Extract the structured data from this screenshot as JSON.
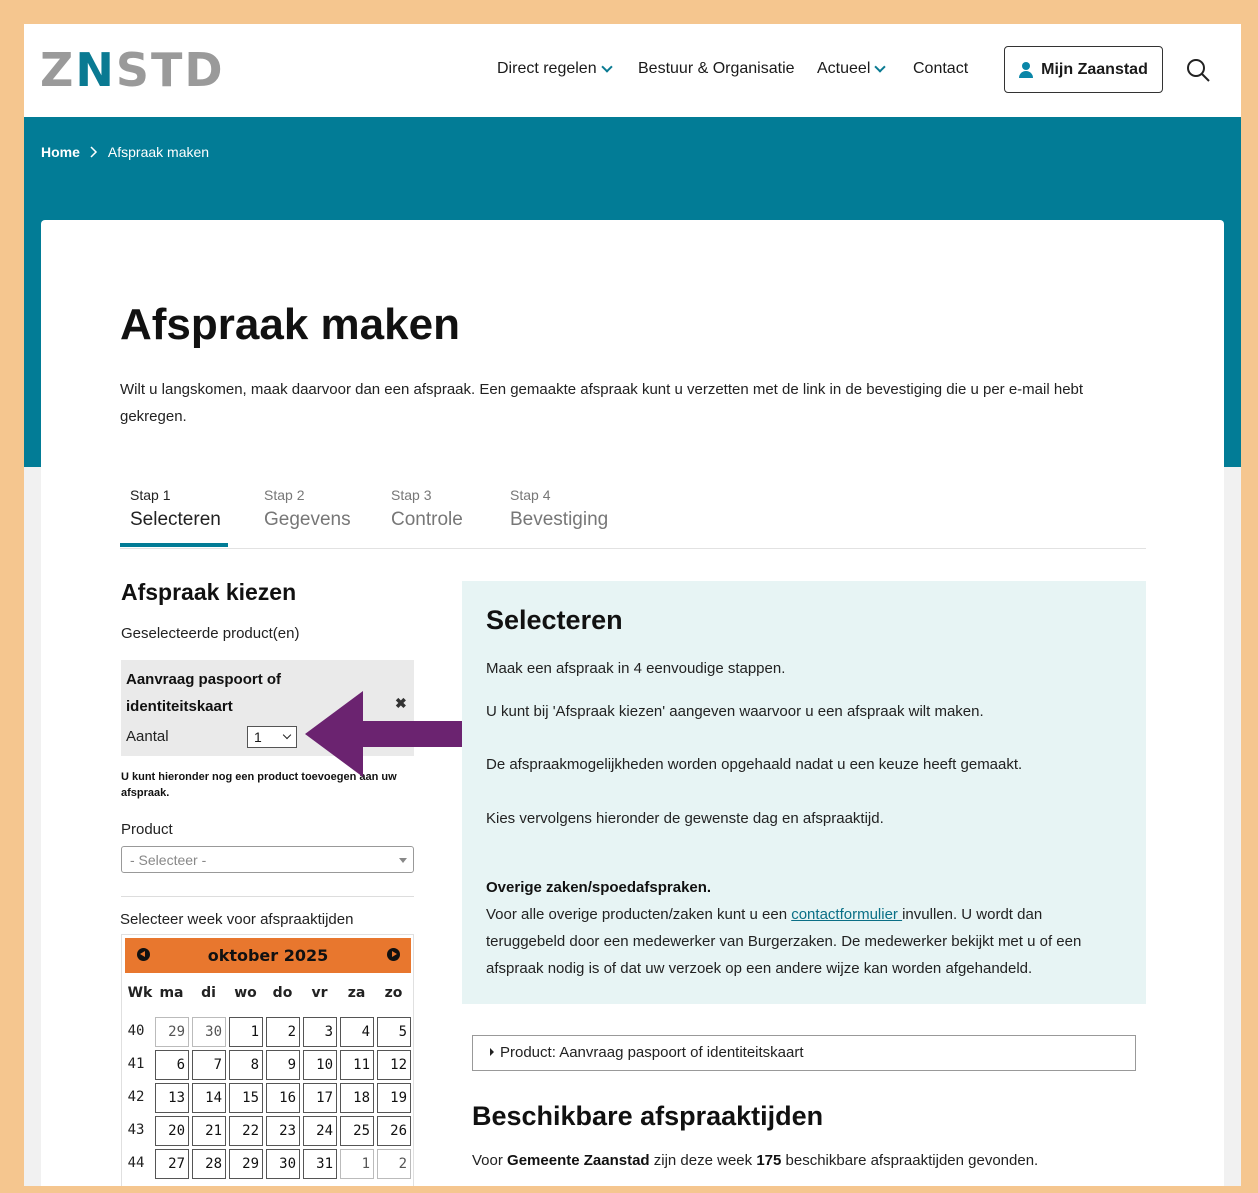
{
  "header": {
    "logo_prefix": "Z",
    "logo_n": "N",
    "logo_suffix": "STD",
    "nav": [
      {
        "label": "Direct regelen",
        "dropdown": true
      },
      {
        "label": "Bestuur & Organisatie",
        "dropdown": false
      },
      {
        "label": "Actueel",
        "dropdown": true
      },
      {
        "label": "Contact",
        "dropdown": false
      }
    ],
    "account_button": "Mijn Zaanstad",
    "search_icon": "search-icon"
  },
  "breadcrumb": {
    "home": "Home",
    "current": "Afspraak maken"
  },
  "page": {
    "title": "Afspraak maken",
    "intro": "Wilt u langskomen, maak daarvoor dan een afspraak. Een gemaakte afspraak kunt u verzetten met de link in de bevestiging die u per e-mail hebt gekregen."
  },
  "steps": [
    {
      "num": "Stap 1",
      "label": "Selecteren",
      "active": true
    },
    {
      "num": "Stap 2",
      "label": "Gegevens",
      "active": false
    },
    {
      "num": "Stap 3",
      "label": "Controle",
      "active": false
    },
    {
      "num": "Stap 4",
      "label": "Bevestiging",
      "active": false
    }
  ],
  "left": {
    "heading": "Afspraak kiezen",
    "selected_label": "Geselecteerde product(en)",
    "selected_product": "Aanvraag paspoort of identiteitskaart",
    "remove_icon": "close-icon",
    "aantal_label": "Aantal",
    "aantal_value": "1",
    "hint": "U kunt hieronder nog een product toevoegen aan uw afspraak.",
    "product_label": "Product",
    "product_placeholder": "- Selecteer -",
    "week_label": "Selecteer week voor afspraaktijden"
  },
  "calendar": {
    "month": "oktober 2025",
    "weekday_headers": [
      "Wk",
      "ma",
      "di",
      "wo",
      "do",
      "vr",
      "za",
      "zo"
    ],
    "rows": [
      {
        "week": "40",
        "days": [
          "29",
          "30",
          "1",
          "2",
          "3",
          "4",
          "5"
        ],
        "dim": [
          true,
          true,
          false,
          false,
          false,
          false,
          false
        ]
      },
      {
        "week": "41",
        "days": [
          "6",
          "7",
          "8",
          "9",
          "10",
          "11",
          "12"
        ],
        "dim": [
          false,
          false,
          false,
          false,
          false,
          false,
          false
        ]
      },
      {
        "week": "42",
        "days": [
          "13",
          "14",
          "15",
          "16",
          "17",
          "18",
          "19"
        ],
        "dim": [
          false,
          false,
          false,
          false,
          false,
          false,
          false
        ]
      },
      {
        "week": "43",
        "days": [
          "20",
          "21",
          "22",
          "23",
          "24",
          "25",
          "26"
        ],
        "dim": [
          false,
          false,
          false,
          false,
          false,
          false,
          false
        ]
      },
      {
        "week": "44",
        "days": [
          "27",
          "28",
          "29",
          "30",
          "31",
          "1",
          "2"
        ],
        "dim": [
          false,
          false,
          false,
          false,
          false,
          true,
          true
        ]
      }
    ],
    "colors": {
      "header": "#e8772e"
    }
  },
  "info": {
    "heading": "Selecteren",
    "p1": "Maak een afspraak in 4 eenvoudige stappen.",
    "p2": "U kunt bij 'Afspraak kiezen' aangeven waarvoor u een afspraak wilt maken.",
    "p3": "De afspraakmogelijkheden worden opgehaald nadat u een keuze heeft gemaakt.",
    "p4": "Kies vervolgens hieronder de gewenste dag en afspraaktijd.",
    "extra_heading": "Overige zaken/spoedafspraken.",
    "extra_before": "Voor alle overige producten/zaken kunt u een ",
    "extra_link": "contactformulier ",
    "extra_after": "invullen. U wordt dan teruggebeld door een medewerker van Burgerzaken. De medewerker bekijkt met u of een afspraak nodig is of dat uw verzoek op een andere wijze kan worden afgehandeld."
  },
  "summary": "Product: Aanvraag paspoort of identiteitskaart",
  "available": {
    "heading": "Beschikbare afspraaktijden",
    "text_before": "Voor ",
    "org": "Gemeente Zaanstad",
    "text_middle": " zijn deze week ",
    "count": "175",
    "text_after": " beschikbare afspraaktijden gevonden."
  },
  "annotation_arrow_color": "#6b2370",
  "colors": {
    "brand_teal": "#027c96",
    "frame": "#f5c68f",
    "info_bg": "#e7f4f4"
  }
}
